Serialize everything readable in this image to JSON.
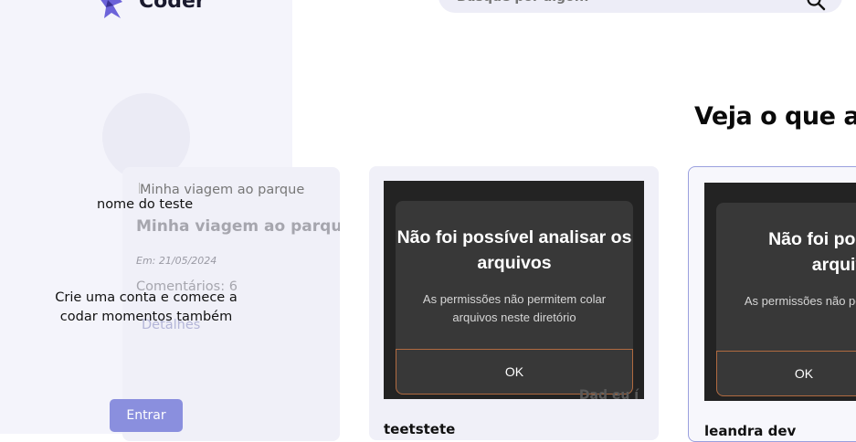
{
  "brand": {
    "name": "Coder"
  },
  "search": {
    "placeholder": "Busque por algo..."
  },
  "profile": {
    "name": "nome do teste",
    "cta": "Crie uma conta e comece a codar momentos também",
    "login_label": "Entrar"
  },
  "main": {
    "heading": "Veja o que an",
    "featured": {
      "image_alt": "Minha viagem ao parque",
      "title": "Minha viagem ao parque",
      "date": "Em: 21/05/2024",
      "comments": "Comentários: 6",
      "details_label": "Detalhes"
    },
    "posts": [
      {
        "author": "teetstete",
        "screenshot": {
          "title": "Não foi possível analisar os arquivos",
          "message": "As permissões não permitem colar arquivos neste diretório",
          "ok": "OK",
          "tail": "Dad eu í"
        }
      },
      {
        "author": "leandra dev",
        "screenshot": {
          "title": "Não foi possível a arquivo",
          "message": "As permissões não permite neste dire",
          "ok": "OK",
          "tail": ""
        }
      }
    ]
  },
  "colors": {
    "accent": "#8a8fde",
    "sidebar": "#f4f4fb",
    "card": "#f0f0f8"
  }
}
